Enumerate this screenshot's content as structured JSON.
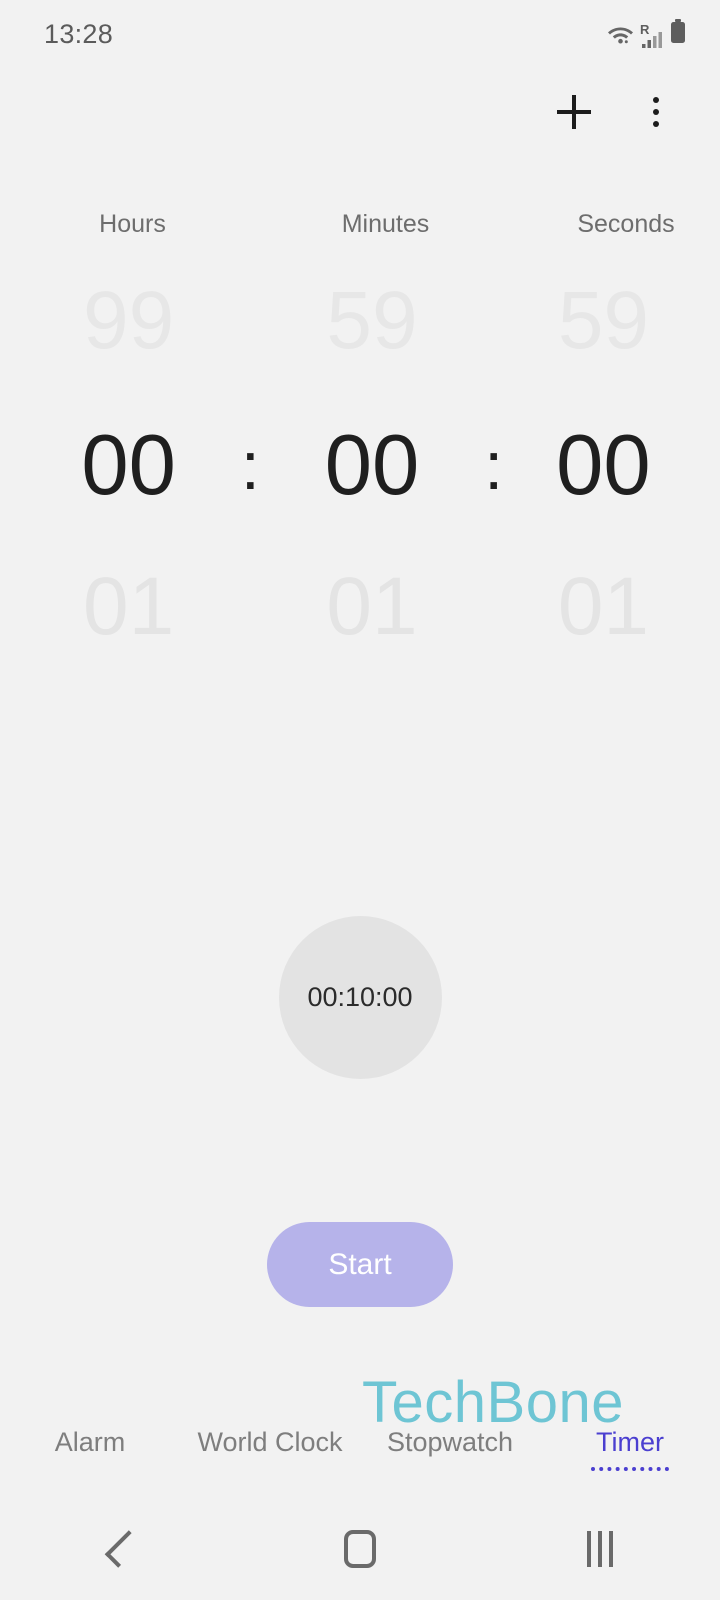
{
  "status_bar": {
    "clock": "13:28",
    "icons": [
      "wifi-icon",
      "signal-roaming-icon",
      "battery-icon"
    ],
    "roaming_indicator": "R"
  },
  "action_bar": {
    "add_label": "+",
    "add_icon": "plus-icon",
    "more_icon": "more-vertical-icon"
  },
  "picker": {
    "labels": {
      "hours": "Hours",
      "minutes": "Minutes",
      "seconds": "Seconds"
    },
    "separator": ":",
    "row_above": {
      "hours": "99",
      "minutes": "59",
      "seconds": "59"
    },
    "row_selected": {
      "hours": "00",
      "minutes": "00",
      "seconds": "00"
    },
    "row_below": {
      "hours": "01",
      "minutes": "01",
      "seconds": "01"
    }
  },
  "preset": {
    "value": "00:10:00"
  },
  "start_button": {
    "label": "Start"
  },
  "watermark": {
    "text": "TechBone"
  },
  "tabs": [
    {
      "label": "Alarm",
      "active": false
    },
    {
      "label": "World Clock",
      "active": false
    },
    {
      "label": "Stopwatch",
      "active": false
    },
    {
      "label": "Timer",
      "active": true
    }
  ],
  "nav_bar": {
    "back": "back-icon",
    "home": "home-icon",
    "recents": "recents-icon"
  },
  "colors": {
    "background": "#f2f2f2",
    "accent_button": "#b6b3ea",
    "active_tab": "#4b3fd0",
    "inactive_tab": "#7e7e7e",
    "watermark": "#6ec5d4",
    "preset_chip": "#e3e3e3",
    "digit_selected": "#1f1f1f",
    "digit_faded": "#e7e7e7"
  }
}
